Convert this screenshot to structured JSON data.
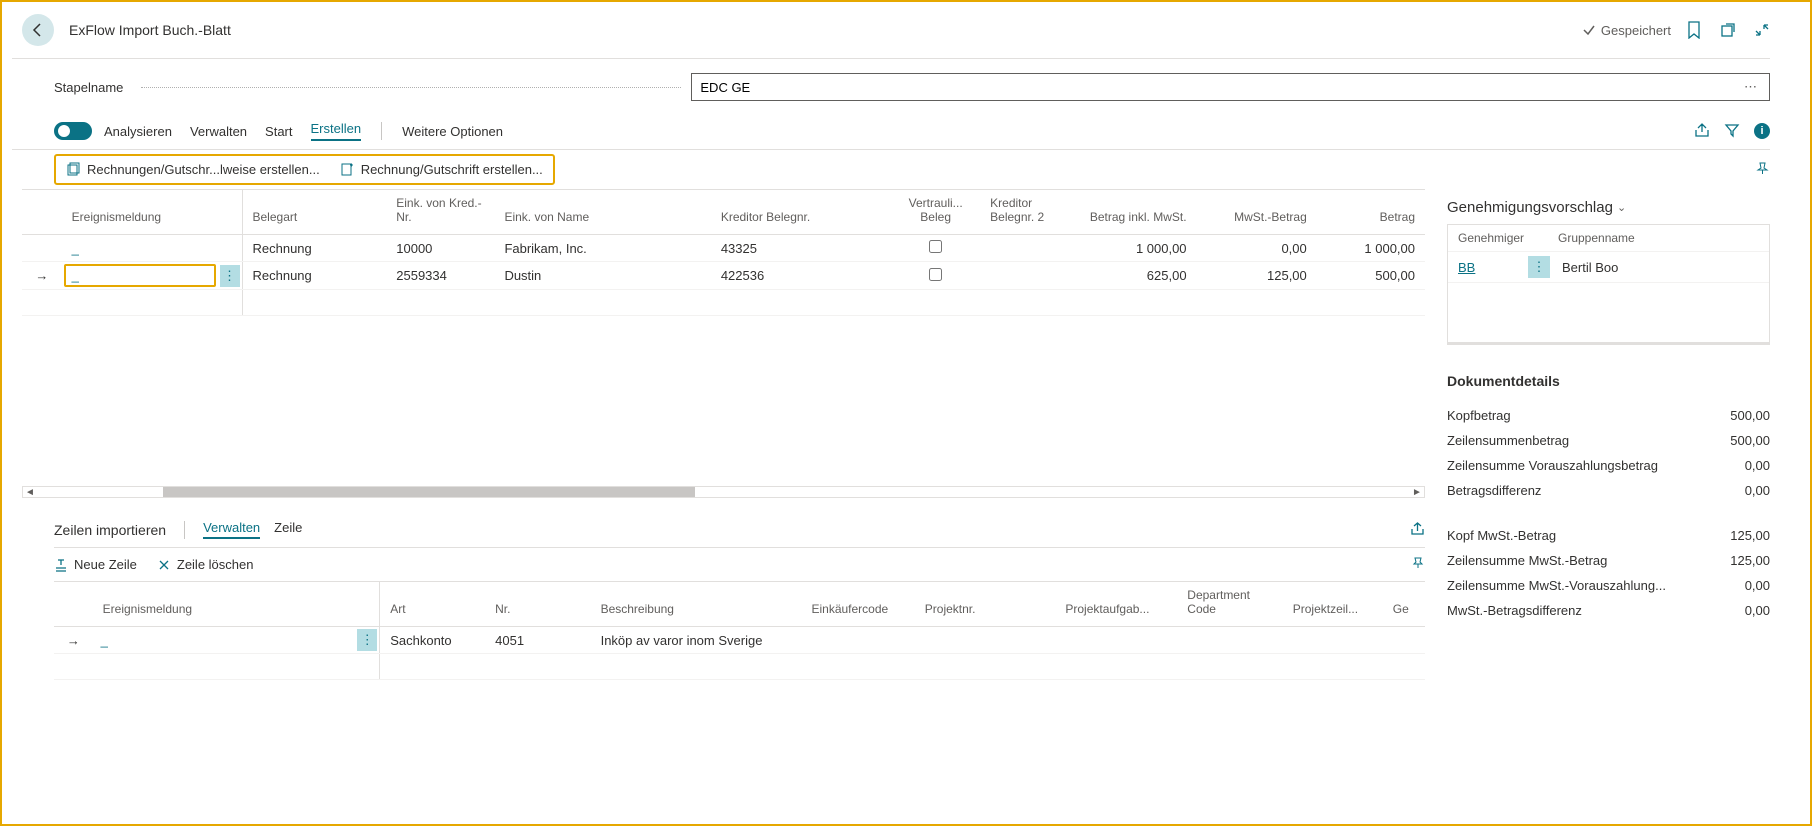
{
  "header": {
    "title": "ExFlow Import Buch.-Blatt",
    "saved_label": "Gespeichert"
  },
  "stapelname": {
    "label": "Stapelname",
    "value": "EDC GE"
  },
  "toolbar": {
    "analysieren": "Analysieren",
    "verwalten": "Verwalten",
    "start": "Start",
    "erstellen": "Erstellen",
    "weitere": "Weitere Optionen"
  },
  "actions": {
    "batch_create": "Rechnungen/Gutschr...lweise erstellen...",
    "single_create": "Rechnung/Gutschrift erstellen..."
  },
  "main_table": {
    "columns": {
      "ereignismeldung": "Ereignismeldung",
      "belegart": "Belegart",
      "eink_von_kred": "Eink. von Kred.-Nr.",
      "eink_von_name": "Eink. von Name",
      "kreditor_belegnr": "Kreditor Belegnr.",
      "vertrauli_beleg": "Vertrauli... Beleg",
      "kreditor_belegnr2": "Kreditor Belegnr. 2",
      "betrag_inkl_mwst": "Betrag inkl. MwSt.",
      "mwst_betrag": "MwSt.-Betrag",
      "betrag": "Betrag"
    },
    "rows": [
      {
        "ereignis": "_",
        "belegart": "Rechnung",
        "kred_nr": "10000",
        "name": "Fabrikam, Inc.",
        "belegnr": "43325",
        "vertrauli": false,
        "belegnr2": "",
        "inkl_mwst": "1 000,00",
        "mwst": "0,00",
        "betrag": "1 000,00"
      },
      {
        "ereignis": "_",
        "belegart": "Rechnung",
        "kred_nr": "2559334",
        "name": "Dustin",
        "belegnr": "422536",
        "vertrauli": false,
        "belegnr2": "",
        "inkl_mwst": "625,00",
        "mwst": "125,00",
        "betrag": "500,00"
      }
    ]
  },
  "subpage": {
    "title": "Zeilen importieren",
    "verwalten": "Verwalten",
    "zeile": "Zeile",
    "neue_zeile": "Neue Zeile",
    "zeile_loeschen": "Zeile löschen",
    "columns": {
      "ereignismeldung": "Ereignismeldung",
      "art": "Art",
      "nr": "Nr.",
      "beschreibung": "Beschreibung",
      "einkaeufercode": "Einkäufercode",
      "projektnr": "Projektnr.",
      "projektaufgab": "Projektaufgab...",
      "department_code": "Department Code",
      "projektzeil": "Projektzeil...",
      "ge": "Ge"
    },
    "rows": [
      {
        "ereignis": "_",
        "art": "Sachkonto",
        "nr": "4051",
        "beschreibung": "Inköp av varor inom Sverige",
        "einkaeufer": "",
        "projektnr": "",
        "projektaufg": "",
        "dept": "",
        "projektzeil": "",
        "ge": ""
      }
    ]
  },
  "approval": {
    "title": "Genehmigungsvorschlag",
    "col_genehmiger": "Genehmiger",
    "col_gruppenname": "Gruppenname",
    "rows": [
      {
        "code": "BB",
        "gruppenname": "Bertil Boo"
      }
    ]
  },
  "details": {
    "title": "Dokumentdetails",
    "kopfbetrag": {
      "label": "Kopfbetrag",
      "value": "500,00"
    },
    "zeilensumme": {
      "label": "Zeilensummenbetrag",
      "value": "500,00"
    },
    "zeilensumme_voraus": {
      "label": "Zeilensumme Vorauszahlungsbetrag",
      "value": "0,00"
    },
    "betragsdiff": {
      "label": "Betragsdifferenz",
      "value": "0,00"
    },
    "kopf_mwst": {
      "label": "Kopf MwSt.-Betrag",
      "value": "125,00"
    },
    "zeilensumme_mwst": {
      "label": "Zeilensumme MwSt.-Betrag",
      "value": "125,00"
    },
    "zeilensumme_mwst_voraus": {
      "label": "Zeilensumme MwSt.-Vorauszahlung...",
      "value": "0,00"
    },
    "mwst_diff": {
      "label": "MwSt.-Betragsdifferenz",
      "value": "0,00"
    }
  }
}
